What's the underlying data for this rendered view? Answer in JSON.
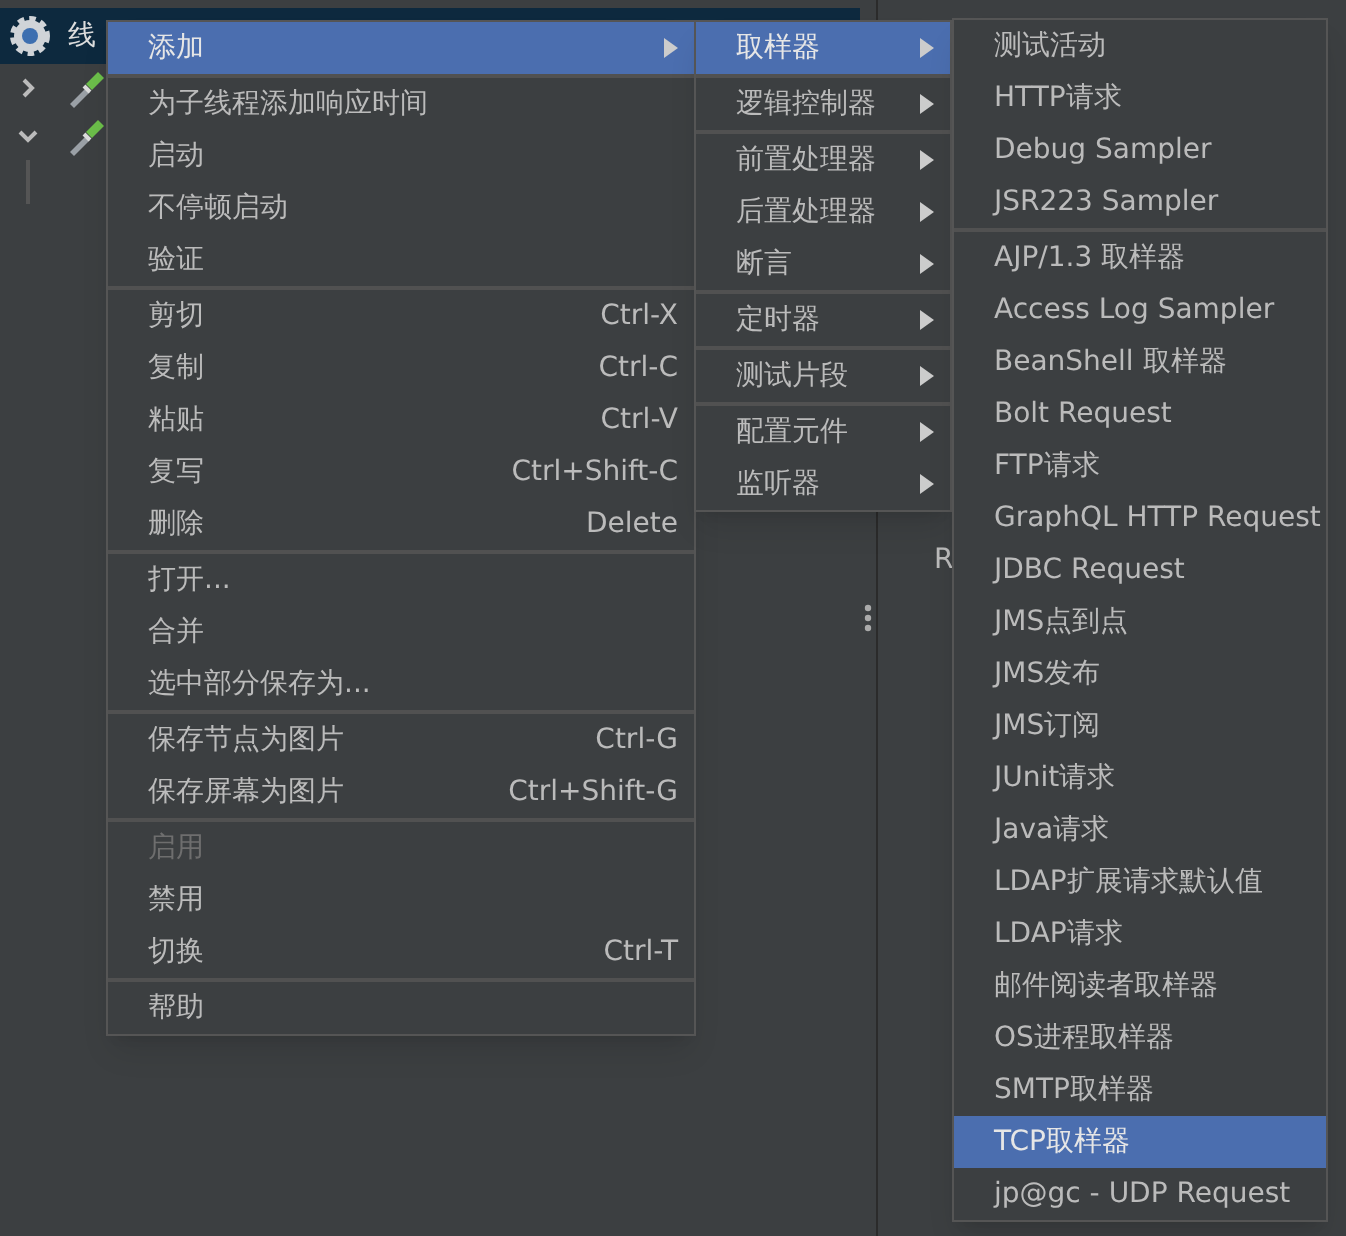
{
  "tree": {
    "root_label": "线",
    "rows": [
      {
        "expanded": false
      },
      {
        "expanded": true
      }
    ]
  },
  "panel": {
    "fragments": [
      "R"
    ]
  },
  "context_menu": {
    "groups": [
      [
        {
          "label": "添加",
          "submenu": true,
          "selected": true,
          "disabled": false
        }
      ],
      [
        {
          "label": "为子线程添加响应时间",
          "submenu": false,
          "selected": false,
          "disabled": false
        },
        {
          "label": "启动",
          "submenu": false,
          "selected": false,
          "disabled": false
        },
        {
          "label": "不停顿启动",
          "submenu": false,
          "selected": false,
          "disabled": false
        },
        {
          "label": "验证",
          "submenu": false,
          "selected": false,
          "disabled": false
        }
      ],
      [
        {
          "label": "剪切",
          "shortcut": "Ctrl-X",
          "submenu": false,
          "selected": false,
          "disabled": false
        },
        {
          "label": "复制",
          "shortcut": "Ctrl-C",
          "submenu": false,
          "selected": false,
          "disabled": false
        },
        {
          "label": "粘贴",
          "shortcut": "Ctrl-V",
          "submenu": false,
          "selected": false,
          "disabled": false
        },
        {
          "label": "复写",
          "shortcut": "Ctrl+Shift-C",
          "submenu": false,
          "selected": false,
          "disabled": false
        },
        {
          "label": "删除",
          "shortcut": "Delete",
          "submenu": false,
          "selected": false,
          "disabled": false
        }
      ],
      [
        {
          "label": "打开...",
          "submenu": false,
          "selected": false,
          "disabled": false
        },
        {
          "label": "合并",
          "submenu": false,
          "selected": false,
          "disabled": false
        },
        {
          "label": "选中部分保存为...",
          "submenu": false,
          "selected": false,
          "disabled": false
        }
      ],
      [
        {
          "label": "保存节点为图片",
          "shortcut": "Ctrl-G",
          "submenu": false,
          "selected": false,
          "disabled": false
        },
        {
          "label": "保存屏幕为图片",
          "shortcut": "Ctrl+Shift-G",
          "submenu": false,
          "selected": false,
          "disabled": false
        }
      ],
      [
        {
          "label": "启用",
          "submenu": false,
          "selected": false,
          "disabled": true
        },
        {
          "label": "禁用",
          "submenu": false,
          "selected": false,
          "disabled": false
        },
        {
          "label": "切换",
          "shortcut": "Ctrl-T",
          "submenu": false,
          "selected": false,
          "disabled": false
        }
      ],
      [
        {
          "label": "帮助",
          "submenu": false,
          "selected": false,
          "disabled": false
        }
      ]
    ]
  },
  "add_submenu": {
    "groups": [
      [
        {
          "label": "取样器",
          "submenu": true,
          "selected": true,
          "disabled": false
        }
      ],
      [
        {
          "label": "逻辑控制器",
          "submenu": true,
          "selected": false,
          "disabled": false
        }
      ],
      [
        {
          "label": "前置处理器",
          "submenu": true,
          "selected": false,
          "disabled": false
        },
        {
          "label": "后置处理器",
          "submenu": true,
          "selected": false,
          "disabled": false
        },
        {
          "label": "断言",
          "submenu": true,
          "selected": false,
          "disabled": false
        }
      ],
      [
        {
          "label": "定时器",
          "submenu": true,
          "selected": false,
          "disabled": false
        }
      ],
      [
        {
          "label": "测试片段",
          "submenu": true,
          "selected": false,
          "disabled": false
        }
      ],
      [
        {
          "label": "配置元件",
          "submenu": true,
          "selected": false,
          "disabled": false
        },
        {
          "label": "监听器",
          "submenu": true,
          "selected": false,
          "disabled": false
        }
      ]
    ]
  },
  "sampler_submenu": {
    "groups": [
      [
        {
          "label": "测试活动",
          "selected": false
        },
        {
          "label": "HTTP请求",
          "selected": false
        },
        {
          "label": "Debug Sampler",
          "selected": false
        },
        {
          "label": "JSR223 Sampler",
          "selected": false
        }
      ],
      [
        {
          "label": "AJP/1.3 取样器",
          "selected": false
        },
        {
          "label": "Access Log Sampler",
          "selected": false
        },
        {
          "label": "BeanShell 取样器",
          "selected": false
        },
        {
          "label": "Bolt Request",
          "selected": false
        },
        {
          "label": "FTP请求",
          "selected": false
        },
        {
          "label": "GraphQL HTTP Request",
          "selected": false
        },
        {
          "label": "JDBC Request",
          "selected": false
        },
        {
          "label": "JMS点到点",
          "selected": false
        },
        {
          "label": "JMS发布",
          "selected": false
        },
        {
          "label": "JMS订阅",
          "selected": false
        },
        {
          "label": "JUnit请求",
          "selected": false
        },
        {
          "label": "Java请求",
          "selected": false
        },
        {
          "label": "LDAP扩展请求默认值",
          "selected": false
        },
        {
          "label": "LDAP请求",
          "selected": false
        },
        {
          "label": "邮件阅读者取样器",
          "selected": false
        },
        {
          "label": "OS进程取样器",
          "selected": false
        },
        {
          "label": "SMTP取样器",
          "selected": false
        },
        {
          "label": "TCP取样器",
          "selected": true
        },
        {
          "label": "jp@gc - UDP Request",
          "selected": false
        }
      ]
    ]
  }
}
